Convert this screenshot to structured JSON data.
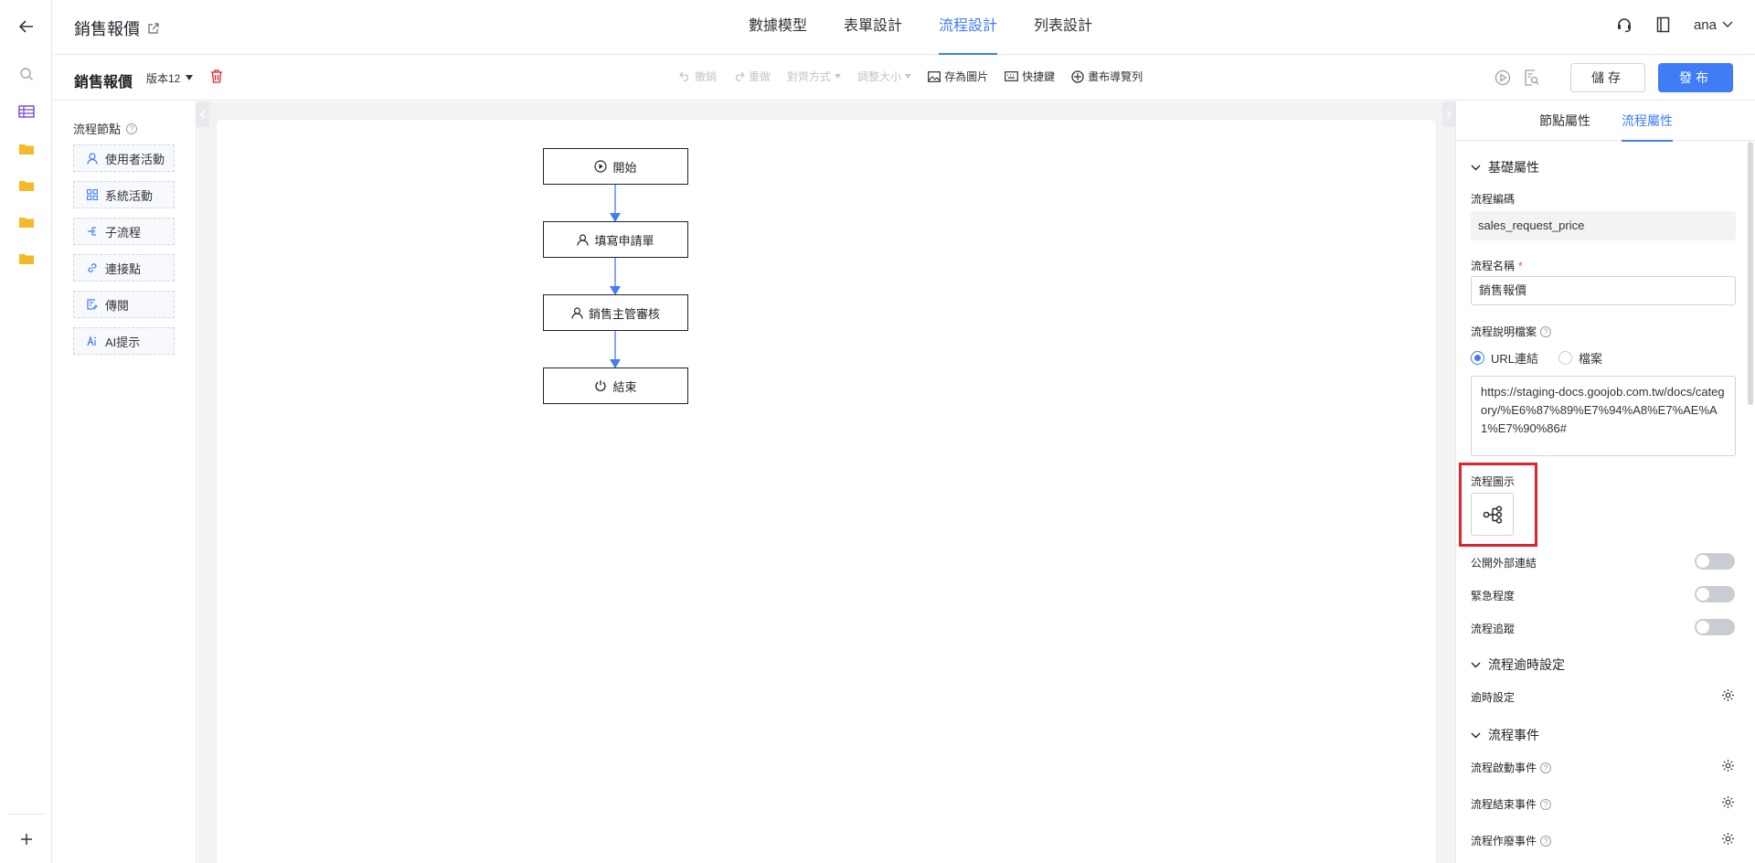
{
  "app": {
    "title": "銷售報價",
    "main_tabs": [
      {
        "label": "數據模型",
        "active": false
      },
      {
        "label": "表單設計",
        "active": false
      },
      {
        "label": "流程設計",
        "active": true
      },
      {
        "label": "列表設計",
        "active": false
      }
    ],
    "user": "ana"
  },
  "toolbar": {
    "doc_name": "銷售報價",
    "version": "版本12",
    "undo": "撤銷",
    "redo": "重做",
    "align": "對齊方式",
    "resize": "調整大小",
    "save_image": "存為圖片",
    "shortcuts": "快捷鍵",
    "canvas_nav": "畫布導覽列",
    "save": "儲存",
    "publish": "發布"
  },
  "nodes_panel": {
    "title": "流程節點",
    "items": [
      {
        "label": "使用者活動",
        "icon": "user-icon"
      },
      {
        "label": "系統活動",
        "icon": "grid-icon"
      },
      {
        "label": "子流程",
        "icon": "subflow-icon"
      },
      {
        "label": "連接點",
        "icon": "link-icon"
      },
      {
        "label": "傳閱",
        "icon": "circulate-icon"
      },
      {
        "label": "AI提示",
        "icon": "ai-icon"
      }
    ]
  },
  "flow": {
    "nodes": [
      {
        "label": "開始",
        "icon": "play-circle-icon"
      },
      {
        "label": "填寫申請單",
        "icon": "user-icon"
      },
      {
        "label": "銷售主管審核",
        "icon": "user-icon"
      },
      {
        "label": "結束",
        "icon": "power-icon"
      }
    ],
    "arrow_color": "#3f7cf6"
  },
  "props": {
    "tabs": [
      {
        "label": "節點屬性",
        "active": false
      },
      {
        "label": "流程屬性",
        "active": true
      }
    ],
    "basic_section": "基礎屬性",
    "code_label": "流程編碼",
    "code_value": "sales_request_price",
    "name_label": "流程名稱",
    "required_mark": "*",
    "name_value": "銷售報價",
    "doc_label": "流程說明檔案",
    "radio_url": "URL連結",
    "radio_file": "檔案",
    "url_value": "https://staging-docs.goojob.com.tw/docs/category/%E6%87%89%E7%94%A8%E7%AE%A1%E7%90%86#",
    "icon_label": "流程圖示",
    "public_link": "公開外部連結",
    "urgency": "緊急程度",
    "tracking": "流程追蹤",
    "timeout_section": "流程逾時設定",
    "timeout_setting": "逾時設定",
    "events_section": "流程事件",
    "start_event": "流程啟動事件",
    "end_event": "流程結束事件",
    "void_event": "流程作廢事件",
    "highlight_color": "#e0242f"
  }
}
